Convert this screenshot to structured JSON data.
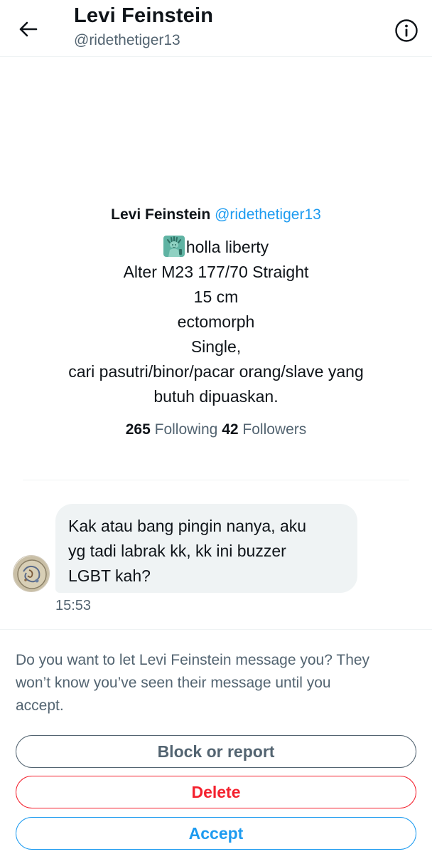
{
  "header": {
    "title": "Levi Feinstein",
    "handle": "@ridethetiger13",
    "back_icon": "arrow-left-icon",
    "info_icon": "info-circle-icon"
  },
  "profile": {
    "name": "Levi Feinstein",
    "handle": "@ridethetiger13",
    "bio": {
      "emoji": "statue-of-liberty",
      "line1": "holla liberty",
      "line2": "Alter M23 177/70 Straight",
      "line3": "15 cm",
      "line4": "ectomorph",
      "line5": "Single,",
      "line6": "cari pasutri/binor/pacar orang/slave yang",
      "line7": "butuh dipuaskan."
    },
    "following_count": "265",
    "following_label": "Following",
    "followers_count": "42",
    "followers_label": "Followers"
  },
  "message": {
    "lines": [
      "Kak atau bang pingin nanya, aku",
      "yg tadi labrak kk, kk ini buzzer",
      "LGBT kah?"
    ],
    "time": "15:53"
  },
  "request": {
    "prompt_lines": [
      "Do you want to let Levi Feinstein message you? They",
      "won’t know you’ve seen their message until you",
      "accept."
    ],
    "block_label": "Block or report",
    "delete_label": "Delete",
    "accept_label": "Accept"
  },
  "colors": {
    "accent": "#1d9bf0",
    "danger": "#f4212e",
    "secondary_text": "#536471",
    "bubble": "#eff3f4"
  }
}
